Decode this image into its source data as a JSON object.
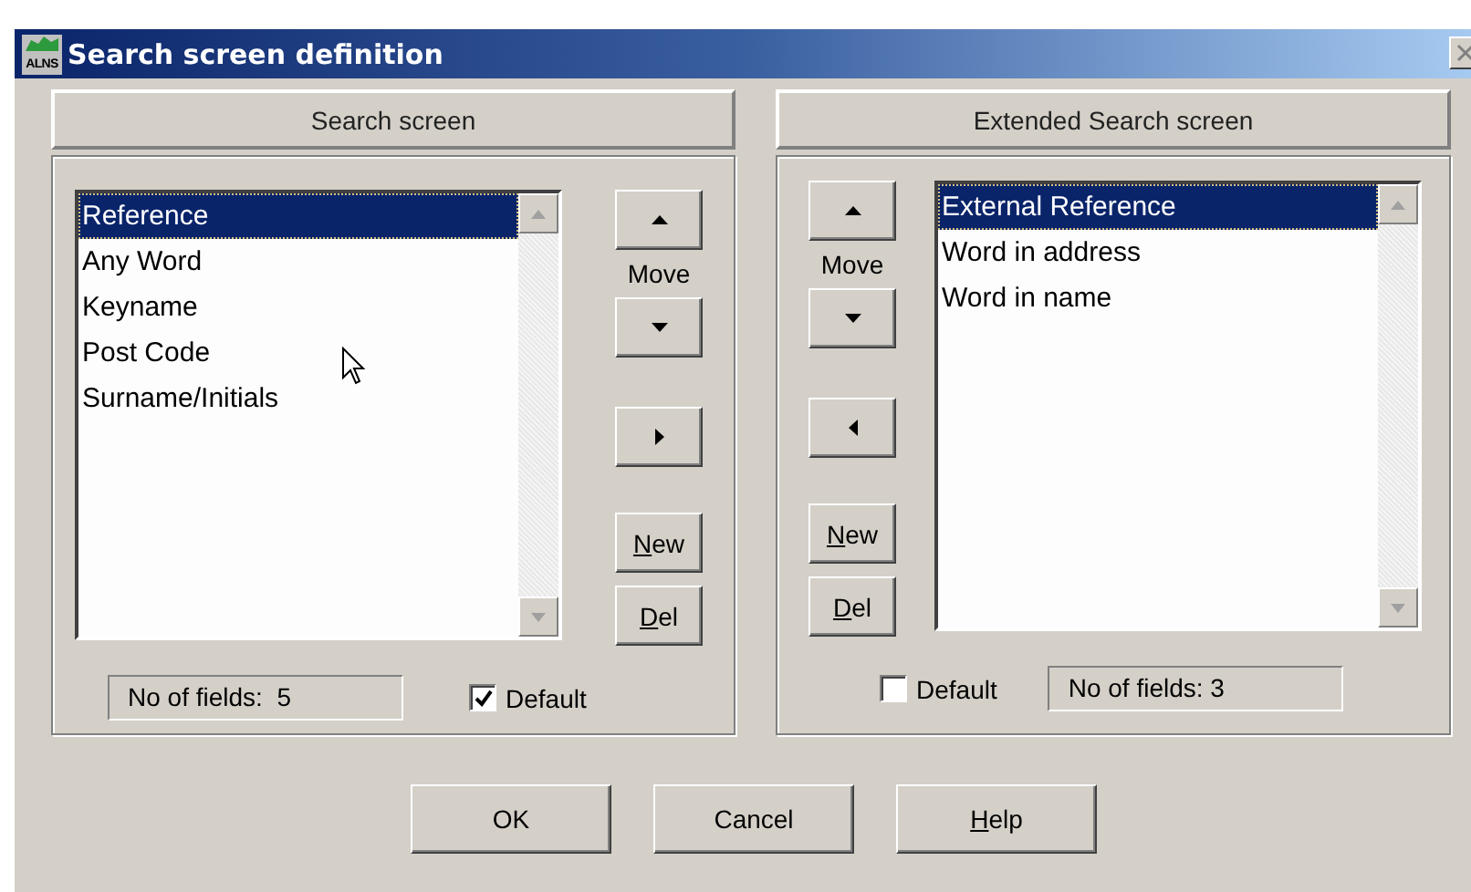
{
  "window": {
    "title": "Search screen definition",
    "logo_text": "ALNS"
  },
  "panels": [
    {
      "header": "Search screen",
      "kind": "source",
      "items": [
        {
          "label": "Reference",
          "selected": true
        },
        {
          "label": "Any Word",
          "selected": false
        },
        {
          "label": "Keyname",
          "selected": false
        },
        {
          "label": "Post Code",
          "selected": false
        },
        {
          "label": "Surname/Initials",
          "selected": false
        }
      ],
      "move_label": "Move",
      "transfer": {
        "kind": "right"
      },
      "new": {
        "mnemonic": "N",
        "rest": "ew"
      },
      "del": {
        "mnemonic": "D",
        "rest": "el"
      },
      "count": "No of fields:  5",
      "default": {
        "label": "Default",
        "checked": true
      }
    },
    {
      "header": "Extended Search screen",
      "kind": "target",
      "items": [
        {
          "label": "External Reference",
          "selected": true
        },
        {
          "label": "Word in address",
          "selected": false
        },
        {
          "label": "Word in name",
          "selected": false
        }
      ],
      "move_label": "Move",
      "transfer": {
        "kind": "left"
      },
      "new": {
        "mnemonic": "N",
        "rest": "ew"
      },
      "del": {
        "mnemonic": "D",
        "rest": "el"
      },
      "count": "No of fields: 3",
      "default": {
        "label": "Default",
        "checked": false
      }
    }
  ],
  "buttons": [
    {
      "rest": "OK"
    },
    {
      "rest": "Cancel"
    },
    {
      "mnemonic": "H",
      "rest": "elp"
    }
  ]
}
